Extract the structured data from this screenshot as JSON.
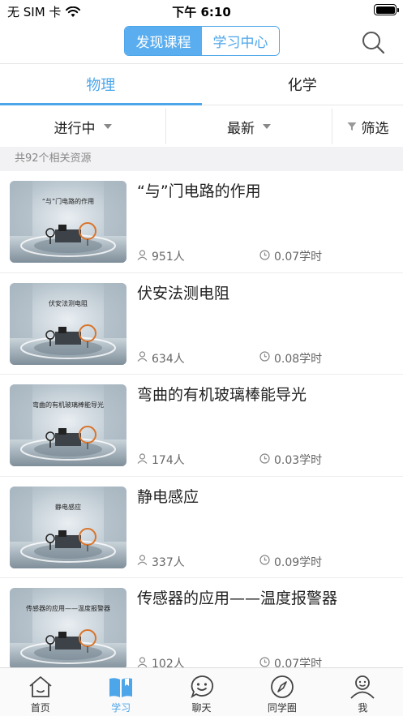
{
  "status_bar": {
    "carrier": "无 SIM 卡",
    "time": "下午 6:10"
  },
  "header": {
    "segments": [
      {
        "label": "发现课程",
        "active": true
      },
      {
        "label": "学习中心",
        "active": false
      }
    ],
    "search_icon": "search-icon"
  },
  "subject_tabs": [
    {
      "label": "物理",
      "active": true
    },
    {
      "label": "化学",
      "active": false
    }
  ],
  "filters": {
    "status": "进行中",
    "sort": "最新",
    "filter": "筛选"
  },
  "result_count": "共92个相关资源",
  "courses": [
    {
      "title": "“与”门电路的作用",
      "thumb_caption": "“与”门电路的作用",
      "people": "951人",
      "hours": "0.07学时"
    },
    {
      "title": "伏安法测电阻",
      "thumb_caption": "伏安法测电阻",
      "people": "634人",
      "hours": "0.08学时"
    },
    {
      "title": "弯曲的有机玻璃棒能导光",
      "thumb_caption": "弯曲的有机玻璃棒能导光",
      "people": "174人",
      "hours": "0.03学时"
    },
    {
      "title": "静电感应",
      "thumb_caption": "静电感应",
      "people": "337人",
      "hours": "0.09学时"
    },
    {
      "title": "传感器的应用——温度报警器",
      "thumb_caption": "传感器的应用——温度报警器",
      "people": "102人",
      "hours": "0.07学时"
    }
  ],
  "bottom_nav": [
    {
      "label": "首页",
      "icon": "home-icon",
      "active": false
    },
    {
      "label": "学习",
      "icon": "book-icon",
      "active": true
    },
    {
      "label": "聊天",
      "icon": "chat-icon",
      "active": false
    },
    {
      "label": "同学圈",
      "icon": "compass-icon",
      "active": false
    },
    {
      "label": "我",
      "icon": "profile-icon",
      "active": false
    }
  ],
  "colors": {
    "accent": "#4da6ea",
    "divider": "#e6e6e6",
    "count_bg": "#f2f2f4"
  }
}
